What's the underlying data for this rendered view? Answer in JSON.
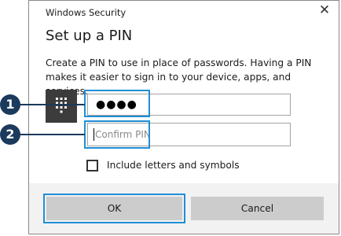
{
  "window": {
    "title": "Windows Security",
    "close_label": "✕"
  },
  "dialog": {
    "heading": "Set up a PIN",
    "description": "Create a PIN to use in place of passwords. Having a PIN makes it easier to sign in to your device, apps, and services."
  },
  "pin": {
    "value": "●●●●",
    "confirm_placeholder": "Confirm PIN"
  },
  "options": {
    "include_letters_label": "Include letters and symbols",
    "include_letters_checked": false
  },
  "buttons": {
    "ok_label": "OK",
    "cancel_label": "Cancel"
  },
  "annotations": [
    {
      "number": "1",
      "target": "pin-field"
    },
    {
      "number": "2",
      "target": "confirm-pin-field"
    }
  ],
  "colors": {
    "highlight": "#1e8fd6",
    "annotation": "#1b3a5c",
    "button": "#cccccc",
    "footer": "#f2f2f2"
  },
  "icons": {
    "keypad": "keypad-icon",
    "close": "close-icon"
  }
}
